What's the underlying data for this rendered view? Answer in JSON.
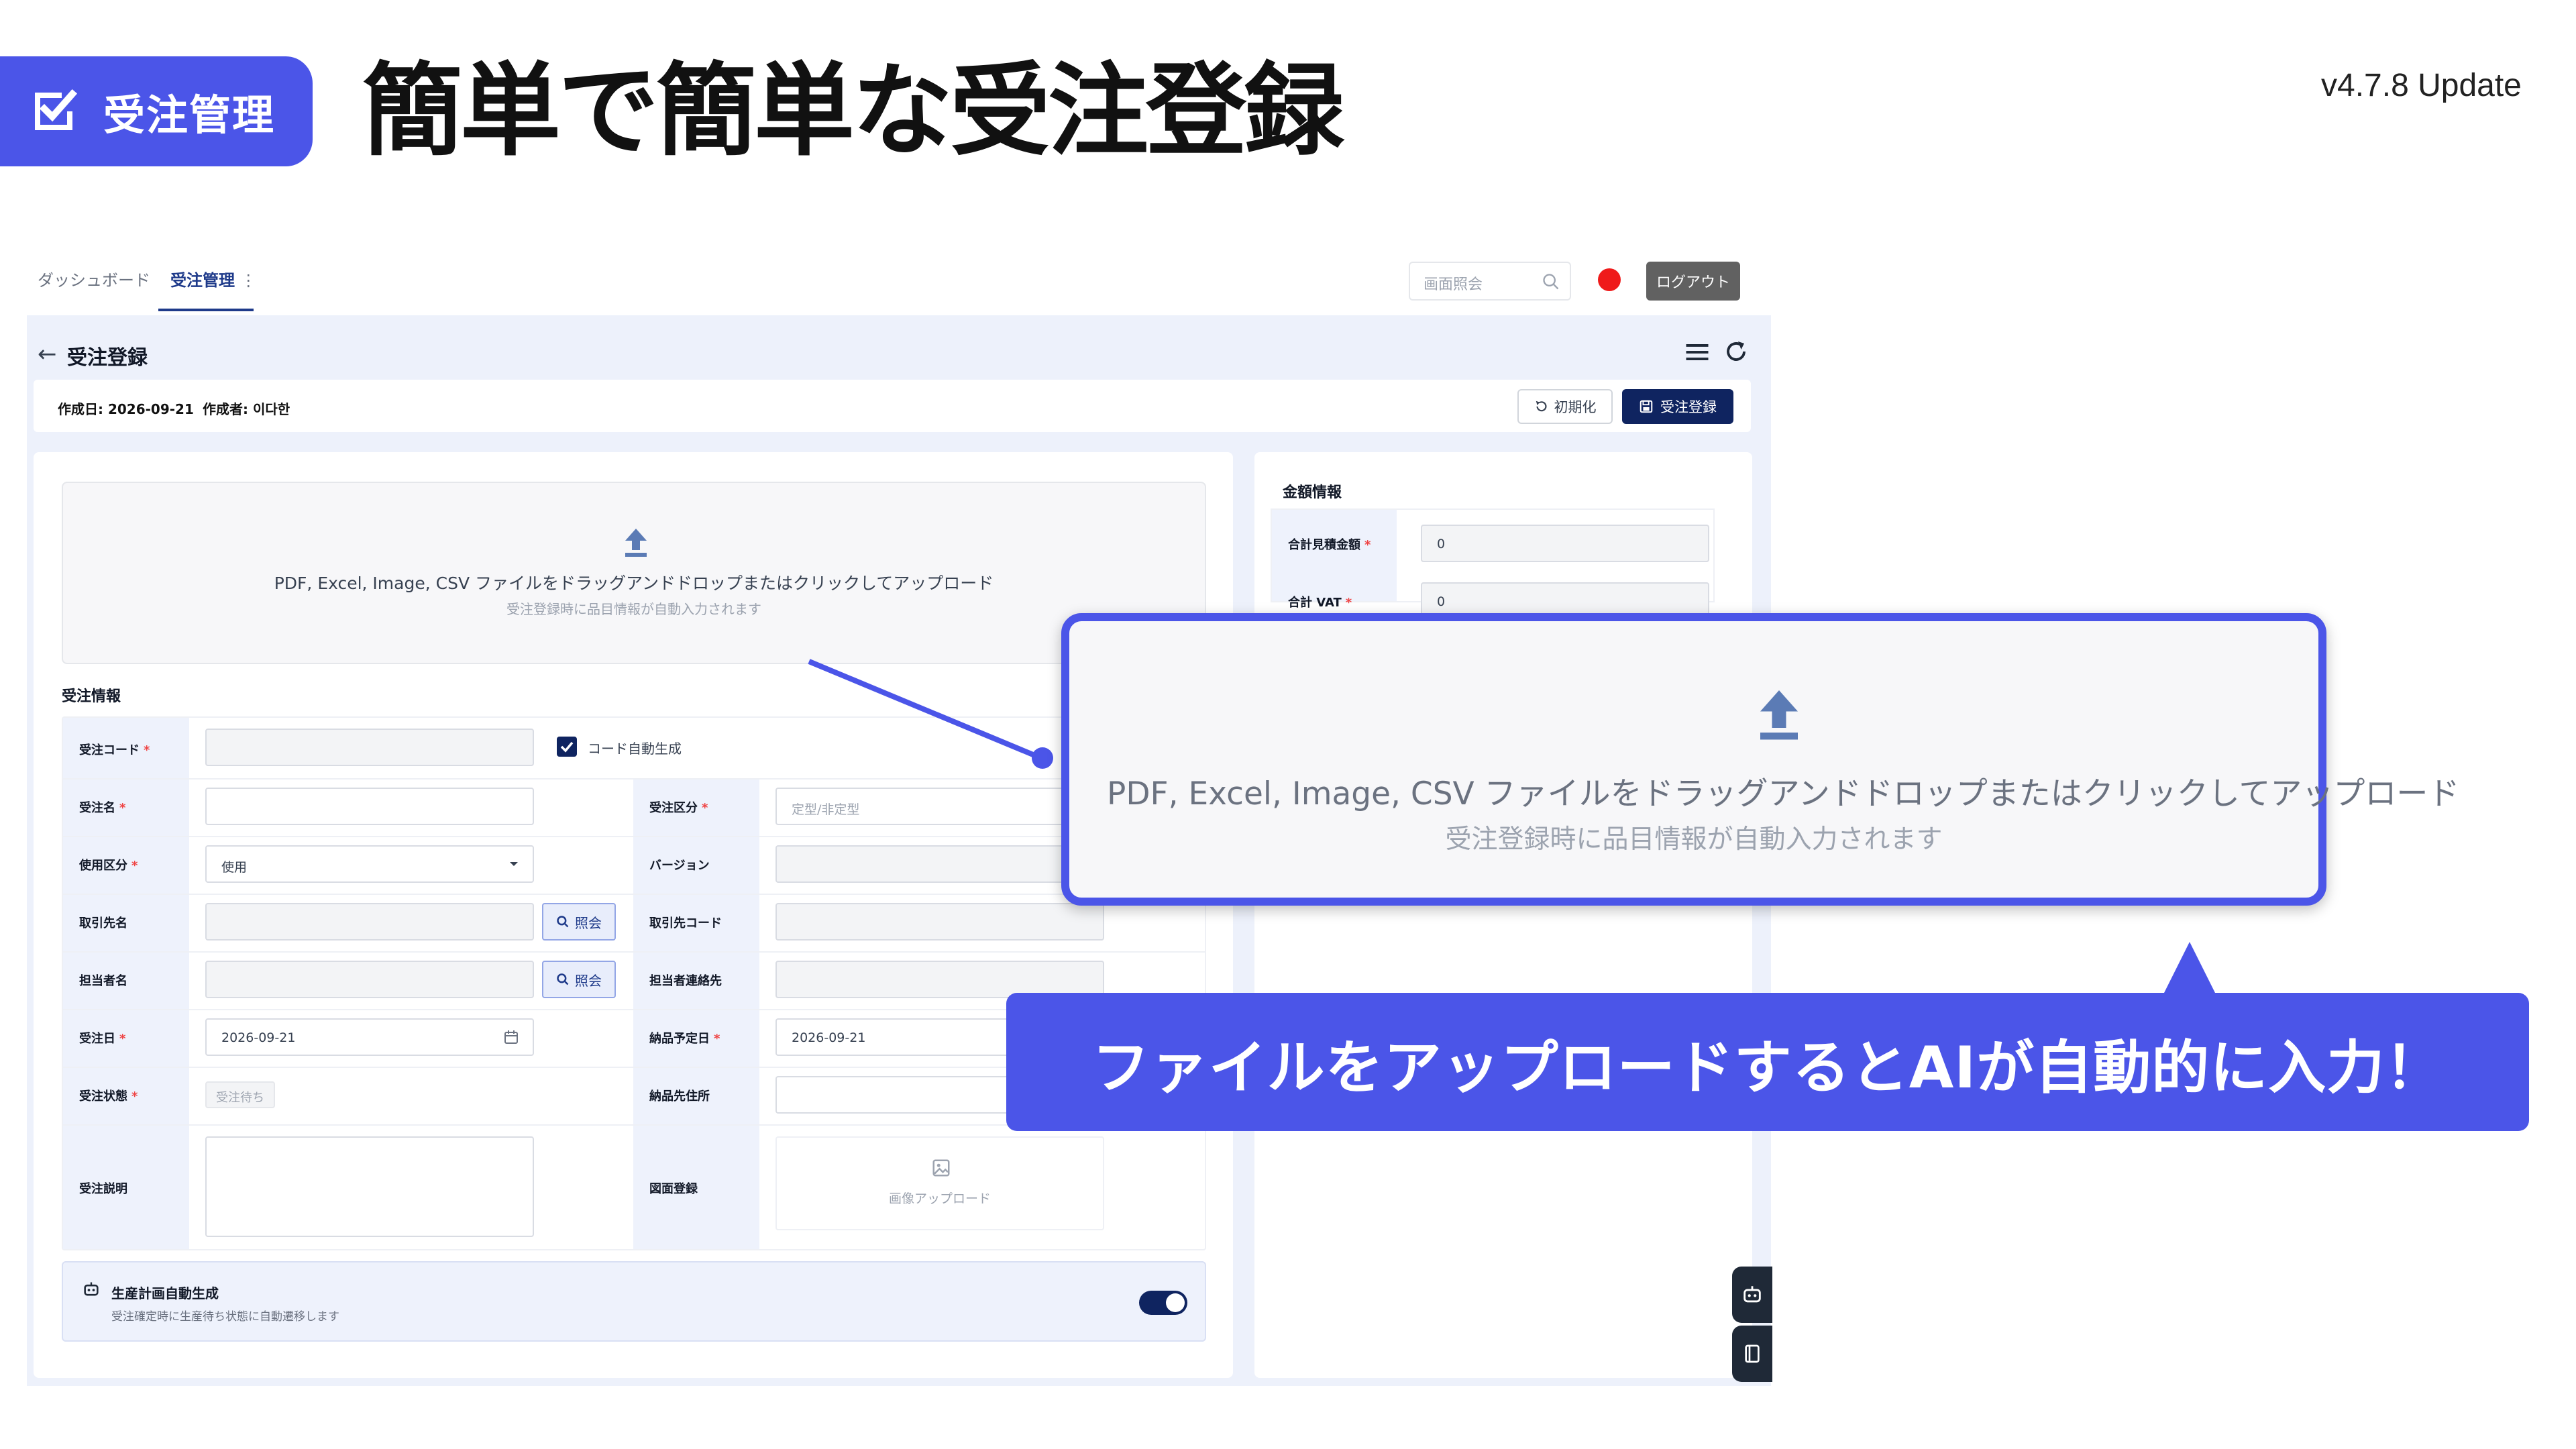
{
  "slide": {
    "badge_label": "受注管理",
    "title": "簡単で簡単な受注登録",
    "version": "v4.7.8 Update"
  },
  "topnav": {
    "tabs": [
      {
        "label": "ダッシュボード",
        "active": false
      },
      {
        "label": "受注管理",
        "active": true
      }
    ],
    "tab_more": "⋮",
    "search_placeholder": "画面照会",
    "logout_label": "ログアウト"
  },
  "page": {
    "back_glyph": "←",
    "title": "受注登録",
    "created_date": "作成日: 2026-09-21",
    "author": "作成者: 이다한",
    "reset_label": "初期化",
    "register_label": "受注登録"
  },
  "upload": {
    "main_text": "PDF, Excel, Image, CSV ファイルをドラッグアンドドロップまたはクリックしてアップロード",
    "sub_text": "受注登録時に品目情報が自動入力されます"
  },
  "order_info": {
    "section_title": "受注情報",
    "left_fields": [
      {
        "label": "受注コード",
        "required": true,
        "value": ""
      },
      {
        "label": "受注名",
        "required": true,
        "value": ""
      },
      {
        "label": "使用区分",
        "required": true,
        "value": "使用"
      },
      {
        "label": "取引先名",
        "required": false,
        "value": "",
        "button": "照会"
      },
      {
        "label": "担当者名",
        "required": false,
        "value": "",
        "button": "照会"
      },
      {
        "label": "受注日",
        "required": true,
        "value": "2026-09-21"
      },
      {
        "label": "受注状態",
        "required": true,
        "value": "受注待ち"
      },
      {
        "label": "受注説明",
        "required": false,
        "value": ""
      }
    ],
    "auto_code_label": "コード自動生成",
    "right_fields": [
      {
        "label": "受注区分",
        "required": true,
        "placeholder": "定型/非定型"
      },
      {
        "label": "バージョン",
        "required": false,
        "value": ""
      },
      {
        "label": "取引先コード",
        "required": false,
        "value": ""
      },
      {
        "label": "担当者連絡先",
        "required": false,
        "value": ""
      },
      {
        "label": "納品予定日",
        "required": true,
        "value": "2026-09-21"
      },
      {
        "label": "納品先住所",
        "required": false,
        "value": ""
      },
      {
        "label": "図面登録",
        "required": false,
        "upload_label": "画像アップロード"
      }
    ]
  },
  "production_plan": {
    "title": "生産計画自動生成",
    "description": "受注確定時に生産待ち状態に自動遷移します",
    "enabled": true
  },
  "amount_info": {
    "section_title": "金額情報",
    "fields": [
      {
        "label": "合計見積金額",
        "required": true,
        "value": "0"
      },
      {
        "label": "合計 VAT",
        "required": true,
        "value": "0"
      }
    ]
  },
  "callout": {
    "text": "ファイルをアップロードするとAIが自動的に入力！"
  },
  "colors": {
    "accent": "#4b55e8",
    "navy": "#0f2460",
    "record_dot": "#ef1a1a"
  }
}
